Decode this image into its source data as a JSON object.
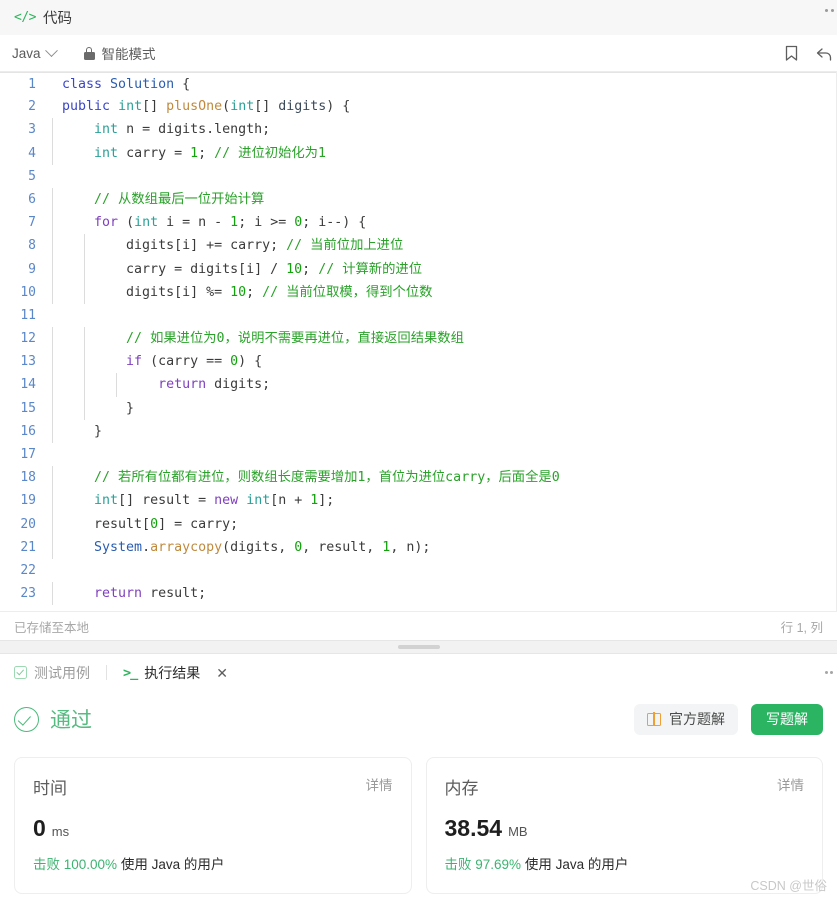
{
  "header": {
    "tab_label": "代码",
    "code_icon": "code-brackets-icon",
    "overflow_icon": "more-dots-icon"
  },
  "toolbar": {
    "language": "Java",
    "chevron_icon": "chevron-down-icon",
    "smart_mode_label": "智能模式",
    "lock_icon": "lock-icon",
    "bookmark_icon": "bookmark-icon",
    "share_icon": "share-arrow-icon"
  },
  "editor": {
    "lines": [
      {
        "n": "1",
        "tokens": [
          {
            "t": "class",
            "c": "t-kw2"
          },
          {
            "t": " ",
            "c": "t-pl"
          },
          {
            "t": "Solution",
            "c": "t-cls"
          },
          {
            "t": " {",
            "c": "t-pl"
          }
        ],
        "guides": []
      },
      {
        "n": "2",
        "tokens": [
          {
            "t": "public",
            "c": "t-kw2"
          },
          {
            "t": " ",
            "c": "t-pl"
          },
          {
            "t": "int",
            "c": "t-type"
          },
          {
            "t": "[] ",
            "c": "t-pl"
          },
          {
            "t": "plusOne",
            "c": "t-fn"
          },
          {
            "t": "(",
            "c": "t-pl"
          },
          {
            "t": "int",
            "c": "t-type"
          },
          {
            "t": "[] ",
            "c": "t-pl"
          },
          {
            "t": "digits",
            "c": "t-var"
          },
          {
            "t": ") {",
            "c": "t-pl"
          }
        ],
        "guides": []
      },
      {
        "n": "3",
        "tokens": [
          {
            "t": "    ",
            "c": "t-pl"
          },
          {
            "t": "int",
            "c": "t-type"
          },
          {
            "t": " n = digits.length;",
            "c": "t-pl"
          }
        ],
        "guides": [
          "g0"
        ]
      },
      {
        "n": "4",
        "tokens": [
          {
            "t": "    ",
            "c": "t-pl"
          },
          {
            "t": "int",
            "c": "t-type"
          },
          {
            "t": " carry = ",
            "c": "t-pl"
          },
          {
            "t": "1",
            "c": "t-num"
          },
          {
            "t": "; ",
            "c": "t-pl"
          },
          {
            "t": "// 进位初始化为1",
            "c": "t-cmt"
          }
        ],
        "guides": [
          "g0"
        ]
      },
      {
        "n": "5",
        "tokens": [
          {
            "t": "",
            "c": "t-pl"
          }
        ],
        "guides": [
          "g0"
        ]
      },
      {
        "n": "6",
        "tokens": [
          {
            "t": "    ",
            "c": "t-pl"
          },
          {
            "t": "// 从数组最后一位开始计算",
            "c": "t-cmt"
          }
        ],
        "guides": [
          "g0"
        ]
      },
      {
        "n": "7",
        "tokens": [
          {
            "t": "    ",
            "c": "t-pl"
          },
          {
            "t": "for",
            "c": "t-kw"
          },
          {
            "t": " (",
            "c": "t-pl"
          },
          {
            "t": "int",
            "c": "t-type"
          },
          {
            "t": " i = n - ",
            "c": "t-pl"
          },
          {
            "t": "1",
            "c": "t-num"
          },
          {
            "t": "; i >= ",
            "c": "t-pl"
          },
          {
            "t": "0",
            "c": "t-num"
          },
          {
            "t": "; i--) {",
            "c": "t-pl"
          }
        ],
        "guides": [
          "g0"
        ]
      },
      {
        "n": "8",
        "tokens": [
          {
            "t": "        digits[i] += carry; ",
            "c": "t-pl"
          },
          {
            "t": "// 当前位加上进位",
            "c": "t-cmt"
          }
        ],
        "guides": [
          "g0",
          "g1"
        ]
      },
      {
        "n": "9",
        "tokens": [
          {
            "t": "        carry = digits[i] / ",
            "c": "t-pl"
          },
          {
            "t": "10",
            "c": "t-num"
          },
          {
            "t": "; ",
            "c": "t-pl"
          },
          {
            "t": "// 计算新的进位",
            "c": "t-cmt"
          }
        ],
        "guides": [
          "g0",
          "g1"
        ]
      },
      {
        "n": "10",
        "tokens": [
          {
            "t": "        digits[i] %= ",
            "c": "t-pl"
          },
          {
            "t": "10",
            "c": "t-num"
          },
          {
            "t": "; ",
            "c": "t-pl"
          },
          {
            "t": "// 当前位取模，得到个位数",
            "c": "t-cmt"
          }
        ],
        "guides": [
          "g0",
          "g1"
        ]
      },
      {
        "n": "11",
        "tokens": [
          {
            "t": "",
            "c": "t-pl"
          }
        ],
        "guides": [
          "g0",
          "g1"
        ]
      },
      {
        "n": "12",
        "tokens": [
          {
            "t": "        ",
            "c": "t-pl"
          },
          {
            "t": "// 如果进位为0，说明不需要再进位，直接返回结果数组",
            "c": "t-cmt"
          }
        ],
        "guides": [
          "g0",
          "g1"
        ]
      },
      {
        "n": "13",
        "tokens": [
          {
            "t": "        ",
            "c": "t-pl"
          },
          {
            "t": "if",
            "c": "t-kw"
          },
          {
            "t": " (carry == ",
            "c": "t-pl"
          },
          {
            "t": "0",
            "c": "t-num"
          },
          {
            "t": ") {",
            "c": "t-pl"
          }
        ],
        "guides": [
          "g0",
          "g1"
        ]
      },
      {
        "n": "14",
        "tokens": [
          {
            "t": "            ",
            "c": "t-pl"
          },
          {
            "t": "return",
            "c": "t-kw"
          },
          {
            "t": " digits;",
            "c": "t-pl"
          }
        ],
        "guides": [
          "g0",
          "g1",
          "g2"
        ]
      },
      {
        "n": "15",
        "tokens": [
          {
            "t": "        }",
            "c": "t-pl"
          }
        ],
        "guides": [
          "g0",
          "g1"
        ]
      },
      {
        "n": "16",
        "tokens": [
          {
            "t": "    }",
            "c": "t-pl"
          }
        ],
        "guides": [
          "g0"
        ]
      },
      {
        "n": "17",
        "tokens": [
          {
            "t": "",
            "c": "t-pl"
          }
        ],
        "guides": [
          "g0"
        ]
      },
      {
        "n": "18",
        "tokens": [
          {
            "t": "    ",
            "c": "t-pl"
          },
          {
            "t": "// 若所有位都有进位，则数组长度需要增加1，首位为进位carry，后面全是0",
            "c": "t-cmt"
          }
        ],
        "guides": [
          "g0"
        ]
      },
      {
        "n": "19",
        "tokens": [
          {
            "t": "    ",
            "c": "t-pl"
          },
          {
            "t": "int",
            "c": "t-type"
          },
          {
            "t": "[] result = ",
            "c": "t-pl"
          },
          {
            "t": "new",
            "c": "t-kw"
          },
          {
            "t": " ",
            "c": "t-pl"
          },
          {
            "t": "int",
            "c": "t-type"
          },
          {
            "t": "[n + ",
            "c": "t-pl"
          },
          {
            "t": "1",
            "c": "t-num"
          },
          {
            "t": "];",
            "c": "t-pl"
          }
        ],
        "guides": [
          "g0"
        ]
      },
      {
        "n": "20",
        "tokens": [
          {
            "t": "    result[",
            "c": "t-pl"
          },
          {
            "t": "0",
            "c": "t-num"
          },
          {
            "t": "] = carry;",
            "c": "t-pl"
          }
        ],
        "guides": [
          "g0"
        ]
      },
      {
        "n": "21",
        "tokens": [
          {
            "t": "    ",
            "c": "t-pl"
          },
          {
            "t": "System",
            "c": "t-cls"
          },
          {
            "t": ".",
            "c": "t-pl"
          },
          {
            "t": "arraycopy",
            "c": "t-fn"
          },
          {
            "t": "(digits, ",
            "c": "t-pl"
          },
          {
            "t": "0",
            "c": "t-num"
          },
          {
            "t": ", result, ",
            "c": "t-pl"
          },
          {
            "t": "1",
            "c": "t-num"
          },
          {
            "t": ", n);",
            "c": "t-pl"
          }
        ],
        "guides": [
          "g0"
        ]
      },
      {
        "n": "22",
        "tokens": [
          {
            "t": "",
            "c": "t-pl"
          }
        ],
        "guides": [
          "g0"
        ]
      },
      {
        "n": "23",
        "tokens": [
          {
            "t": "    ",
            "c": "t-pl"
          },
          {
            "t": "return",
            "c": "t-kw"
          },
          {
            "t": " result;",
            "c": "t-pl"
          }
        ],
        "guides": [
          "g0"
        ]
      }
    ]
  },
  "status_bar": {
    "save_state": "已存储至本地",
    "cursor_position": "行 1, 列"
  },
  "panel": {
    "testcase_tab": "测试用例",
    "result_tab": "执行结果",
    "checkbox_icon": "checkbox-checked-icon",
    "terminal_icon": "terminal-prompt-icon",
    "close_icon": "close-x-icon",
    "overflow_icon": "more-dots-icon"
  },
  "result": {
    "status_text": "通过",
    "status_icon": "circle-check-icon",
    "status_color": "#56bb81",
    "official_solution_label": "官方题解",
    "official_solution_icon": "book-icon",
    "write_solution_label": "写题解",
    "write_solution_color": "#2bb563",
    "cards": [
      {
        "title": "时间",
        "detail_label": "详情",
        "value": "0",
        "unit": "ms",
        "beat_prefix": "击败",
        "beat_percent": "100.00%",
        "beat_suffix": "使用 Java 的用户"
      },
      {
        "title": "内存",
        "detail_label": "详情",
        "value": "38.54",
        "unit": "MB",
        "beat_prefix": "击败",
        "beat_percent": "97.69%",
        "beat_suffix": "使用 Java 的用户"
      }
    ]
  },
  "watermark": "CSDN @世俗"
}
